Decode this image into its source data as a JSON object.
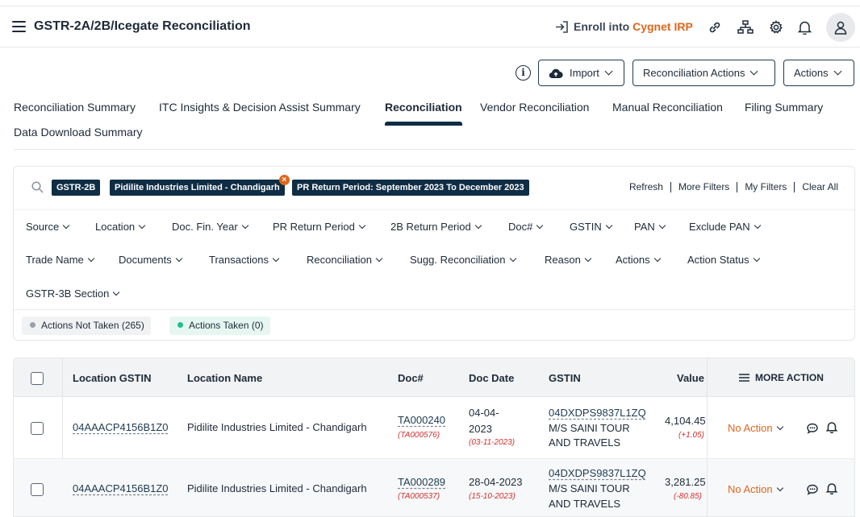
{
  "header": {
    "title": "GSTR-2A/2B/Icegate Reconciliation",
    "enroll_prefix": "Enroll into ",
    "enroll_brand": "Cygnet IRP"
  },
  "toolbar": {
    "import_label": "Import",
    "recon_actions_label": "Reconciliation Actions",
    "actions_label": "Actions"
  },
  "tabs": [
    {
      "label": "Reconciliation Summary"
    },
    {
      "label": "ITC Insights & Decision Assist Summary"
    },
    {
      "label": "Reconciliation"
    },
    {
      "label": "Vendor Reconciliation"
    },
    {
      "label": "Manual Reconciliation"
    },
    {
      "label": "Filing Summary"
    },
    {
      "label": "Data Download Summary"
    }
  ],
  "active_tab": "Reconciliation",
  "filters": {
    "chips": [
      {
        "label": "GSTR-2B"
      },
      {
        "label": "Pidilite Industries Limited - Chandigarh"
      },
      {
        "label": "PR Return Period: September 2023 To December 2023"
      }
    ],
    "links": [
      "Refresh",
      "More Filters",
      "My Filters",
      "Clear All"
    ],
    "dropdowns": [
      "Source",
      "Location",
      "Doc. Fin. Year",
      "PR Return Period",
      "2B Return Period",
      "Doc#",
      "GSTIN",
      "PAN",
      "Exclude PAN",
      "Trade Name",
      "Documents",
      "Transactions",
      "Reconciliation",
      "Sugg. Reconciliation",
      "Reason",
      "Actions",
      "Action Status",
      "GSTR-3B Section"
    ],
    "status": {
      "not_taken": "Actions Not Taken (265)",
      "taken": "Actions Taken (0)"
    }
  },
  "table": {
    "headers": {
      "location_gstin": "Location GSTIN",
      "location_name": "Location Name",
      "doc_no": "Doc#",
      "doc_date": "Doc Date",
      "gstin": "GSTIN",
      "value": "Value",
      "more_action": "MORE ACTION"
    },
    "rows": [
      {
        "location_gstin": "04AAACP4156B1Z0",
        "location_name": "Pidilite Industries Limited - Chandigarh",
        "doc_no": "TA000240",
        "doc_no_sub": "(TA000576)",
        "doc_date_1": "04-04-",
        "doc_date_2": "2023",
        "doc_date_sub": "(03-11-2023)",
        "gstin": "04DXDPS9837L1ZQ",
        "vendor_1": "M/S SAINI TOUR",
        "vendor_2": "AND TRAVELS",
        "value": "4,104.45",
        "value_sub": "(+1.05)",
        "action": "No Action"
      },
      {
        "location_gstin": "04AAACP4156B1Z0",
        "location_name": "Pidilite Industries Limited - Chandigarh",
        "doc_no": "TA000289",
        "doc_no_sub": "(TA000537)",
        "doc_date_1": "28-04-2023",
        "doc_date_2": "",
        "doc_date_sub": "(15-10-2023)",
        "gstin": "04DXDPS9837L1ZQ",
        "vendor_1": "M/S SAINI TOUR",
        "vendor_2": "AND TRAVELS",
        "value": "3,281.25",
        "value_sub": "(-80.85)",
        "action": "No Action"
      }
    ]
  },
  "colors": {
    "accent": "#e0661c",
    "primary_dark": "#0f2d44",
    "negative": "#d0312d",
    "taken_dot": "#1fbf8f",
    "not_taken_dot": "#9aa1a9"
  },
  "icons": [
    "menu-icon",
    "login-arrow-icon",
    "link-icon",
    "hierarchy-icon",
    "gear-icon",
    "bell-icon",
    "user-icon",
    "info-icon",
    "cloud-upload-icon",
    "search-icon",
    "comment-icon",
    "bell-icon"
  ]
}
